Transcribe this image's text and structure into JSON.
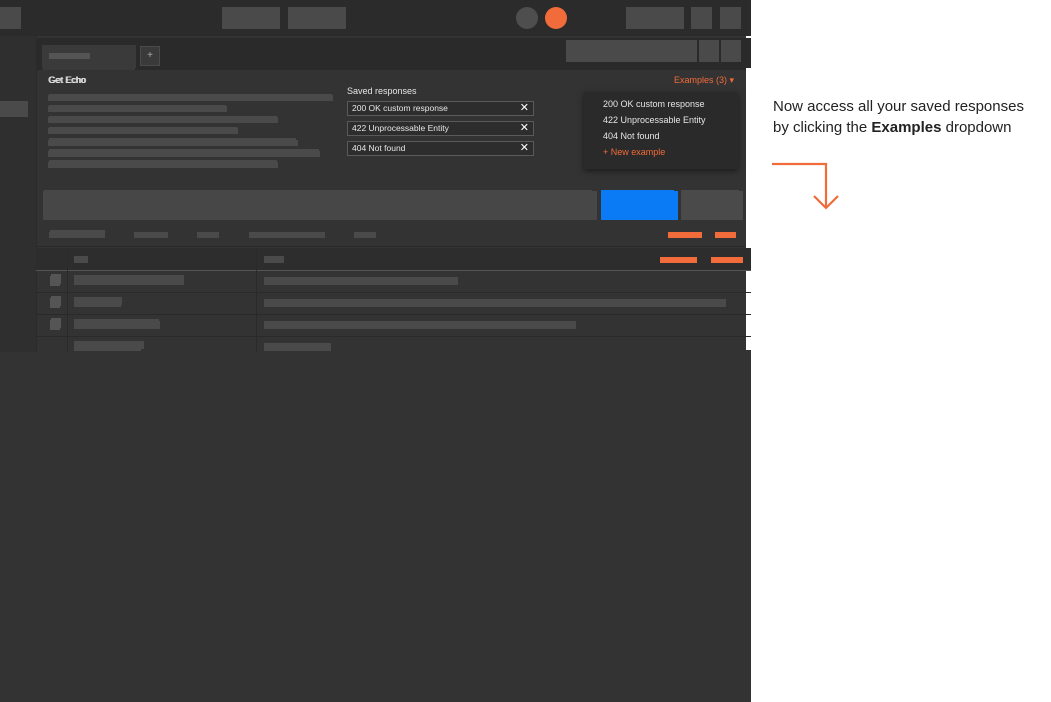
{
  "back_window": {
    "tab_add": "+",
    "request_title": "Get Echo",
    "saved_responses_heading": "Saved responses",
    "saved_responses": [
      {
        "label": "200 OK custom response",
        "remove": "✕"
      },
      {
        "label": "422 Unprocessable Entity",
        "remove": "✕"
      },
      {
        "label": "404 Not found",
        "remove": "✕"
      }
    ]
  },
  "front_window": {
    "tab_add": "+",
    "request_title": "Get Echo",
    "examples_dropdown": "Examples (3) ▾",
    "examples": [
      {
        "label": "200 OK custom response"
      },
      {
        "label": "422 Unprocessable Entity"
      },
      {
        "label": "404 Not found"
      }
    ],
    "new_example": "+ New example"
  },
  "annotation": {
    "line1": "Now access all your saved responses",
    "line2_prefix": "by clicking the ",
    "line2_bold": "Examples",
    "line2_suffix": " dropdown"
  },
  "colors": {
    "accent_orange": "#f26b3a",
    "send_blue": "#0a7af5",
    "window_bg": "#333333"
  }
}
